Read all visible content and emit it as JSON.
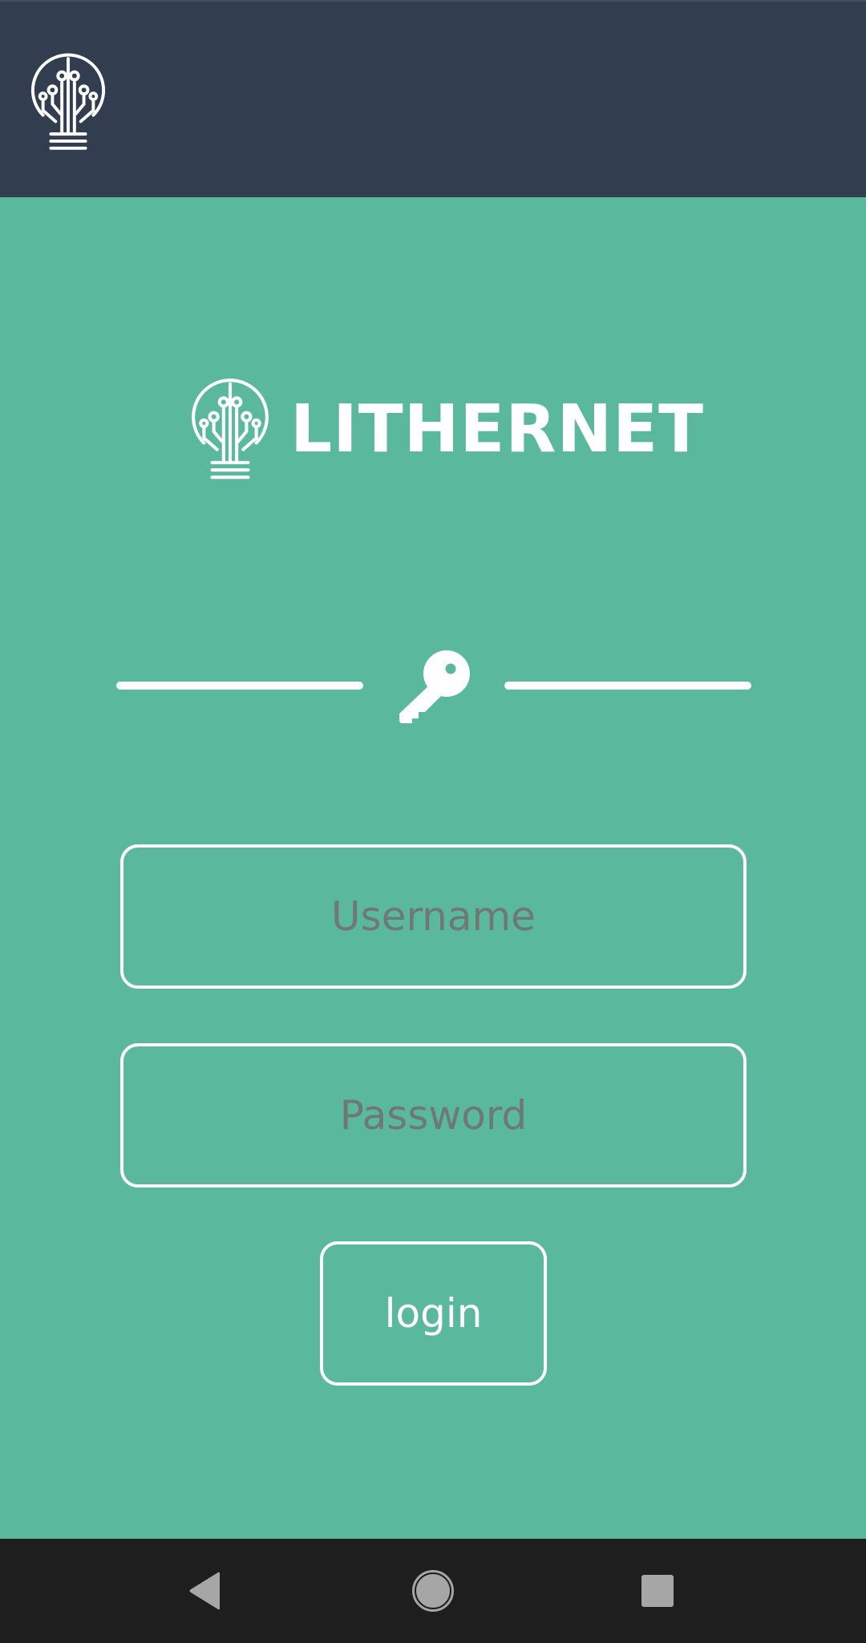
{
  "app": {
    "brand_name": "LITHERNET"
  },
  "login_form": {
    "username_placeholder": "Username",
    "password_placeholder": "Password",
    "login_label": "login"
  },
  "icons": {
    "app_logo": "lightbulb-circuit-icon",
    "key": "key-icon",
    "nav_back": "back-triangle-icon",
    "nav_home": "home-circle-icon",
    "nav_recents": "recents-square-icon"
  },
  "colors": {
    "topbar_bg": "#323e50",
    "main_bg": "#5ab99c",
    "navbar_bg": "#1e1e1e",
    "foreground": "#ffffff",
    "placeholder_text": "#6f7872",
    "nav_icon": "#a6a6a6"
  }
}
